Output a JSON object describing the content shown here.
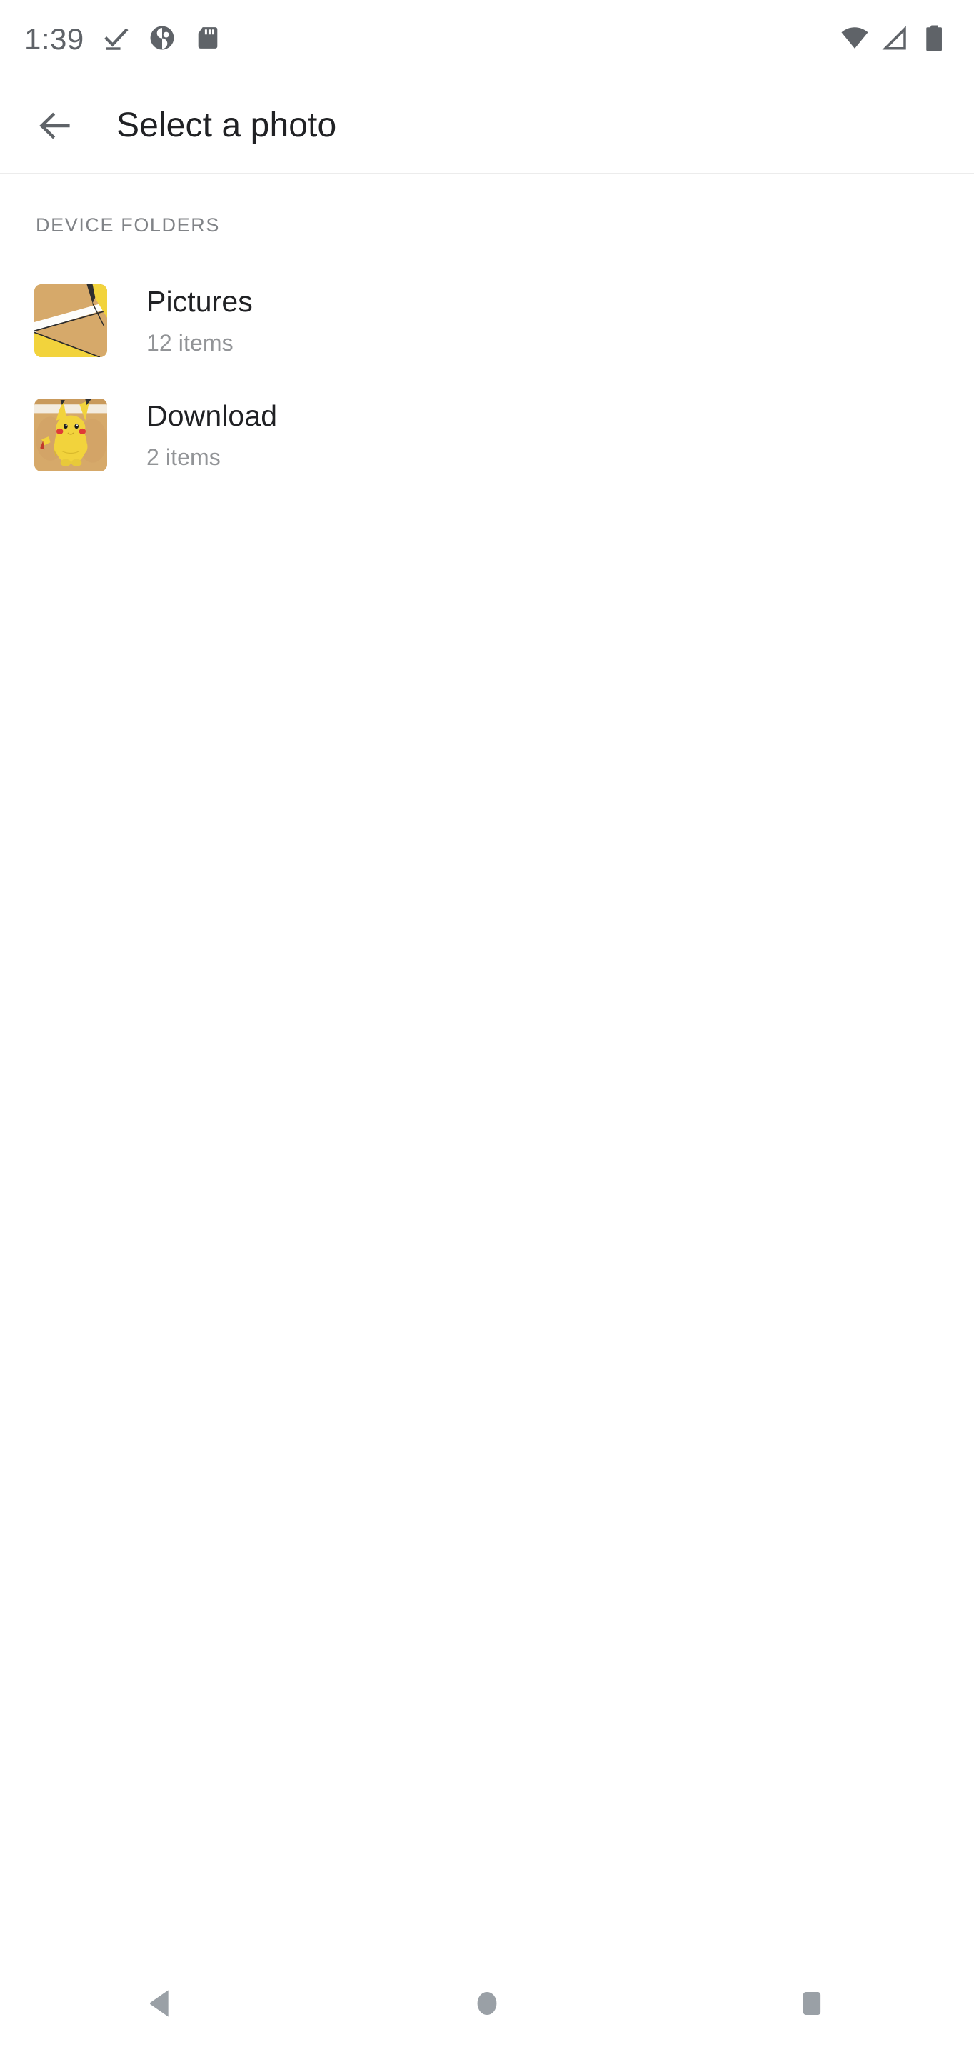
{
  "status_bar": {
    "clock": "1:39",
    "left_icons": [
      {
        "name": "checkmark-icon",
        "glyph": "check"
      },
      {
        "name": "contrast-accessibility-icon",
        "glyph": "contrast"
      },
      {
        "name": "sd-card-icon",
        "glyph": "sdcard"
      }
    ],
    "right_icons": [
      {
        "name": "wifi-icon",
        "glyph": "wifi"
      },
      {
        "name": "cellular-signal-icon",
        "glyph": "signal"
      },
      {
        "name": "battery-icon",
        "glyph": "battery"
      }
    ],
    "icon_color": "#5f6368"
  },
  "toolbar": {
    "back_label": "Back",
    "title": "Select a photo"
  },
  "content": {
    "section_header": "DEVICE FOLDERS",
    "folders": [
      {
        "name": "Pictures",
        "count": "12 items",
        "thumbnail": "pikachu-zoomed-thumbnail"
      },
      {
        "name": "Download",
        "count": "2 items",
        "thumbnail": "pikachu-thumbnail"
      }
    ]
  },
  "nav_bar": {
    "buttons": [
      {
        "name": "nav-back-button",
        "label": "Back"
      },
      {
        "name": "nav-home-button",
        "label": "Home"
      },
      {
        "name": "nav-recents-button",
        "label": "Recents"
      }
    ],
    "color": "#9aa0a6"
  },
  "colors": {
    "background": "#ffffff",
    "primary_text": "#202124",
    "secondary_text": "#929497",
    "header_text": "#808387",
    "divider": "#ececec",
    "pikachu_yellow": "#f2d33c",
    "pikachu_tan": "#d6a96a"
  }
}
